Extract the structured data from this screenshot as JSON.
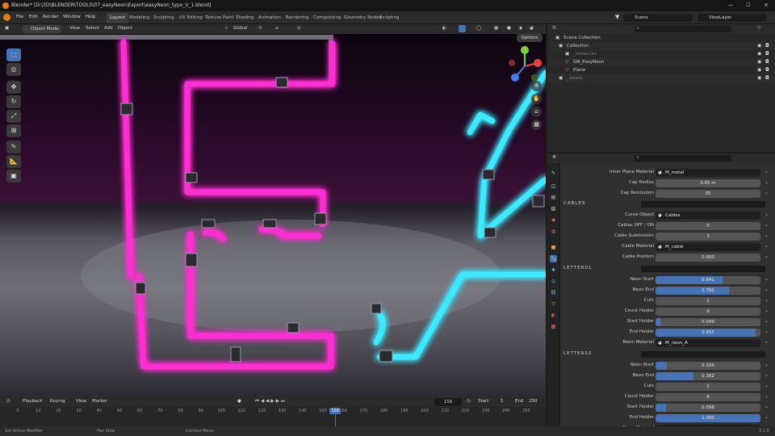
{
  "titlebar": {
    "title": "Blender* [D:\\3D\\BLENDER\\TOOLS\\07_easyNeon\\Export\\easyNeon_typo_V_1.blend]"
  },
  "menu": [
    "File",
    "Edit",
    "Render",
    "Window",
    "Help"
  ],
  "workspaces": [
    "Layout",
    "Modeling",
    "Sculpting",
    "UV Editing",
    "Texture Paint",
    "Shading",
    "Animation",
    "Rendering",
    "Compositing",
    "Geometry Nodes",
    "Scripting"
  ],
  "scene": {
    "scene_name": "Scene",
    "view_layer": "ViewLayer"
  },
  "viewport_header": {
    "mode": "Object Mode",
    "menus": [
      "View",
      "Select",
      "Add",
      "Object"
    ],
    "orientation": "Global",
    "options": "Options"
  },
  "timeline": {
    "menus": [
      "Playback",
      "Keying",
      "View",
      "Marker"
    ],
    "current_frame": "156",
    "start_label": "Start",
    "start": "1",
    "end_label": "End",
    "end": "250",
    "ticks": [
      "0",
      "10",
      "20",
      "30",
      "40",
      "50",
      "60",
      "70",
      "80",
      "90",
      "100",
      "110",
      "120",
      "130",
      "140",
      "150",
      "160",
      "170",
      "180",
      "190",
      "200",
      "210",
      "220",
      "230",
      "240",
      "250"
    ],
    "playhead": "156"
  },
  "statusbar": {
    "left": "Set Active Modifier",
    "middle": "Pan View",
    "right": "Context Menu",
    "version": "3.1.0"
  },
  "outliner": {
    "rows": [
      {
        "label": "Scene Collection",
        "selected": false
      },
      {
        "label": "Collection",
        "selected": false
      },
      {
        "label": "_instances",
        "selected": false
      },
      {
        "label": "GN_EasyNeon",
        "selected": true
      },
      {
        "label": "Plane",
        "selected": false
      },
      {
        "label": "_assets",
        "selected": false
      }
    ]
  },
  "properties": {
    "inner_plane_material": {
      "label": "Inner Plane Material",
      "value": "M_metal"
    },
    "cap_radius": {
      "label": "Cap Radius",
      "value": "0.05 m"
    },
    "cap_resolution": {
      "label": "Cap Resolution",
      "value": "35"
    },
    "cables_section": "CABLES",
    "curve_object": {
      "label": "Curve Object",
      "value": "Cables"
    },
    "cables_off_on": {
      "label": "Cables OFF / ON",
      "value": "0"
    },
    "cable_subdivision": {
      "label": "Cable Subdivision",
      "value": "3"
    },
    "cable_material": {
      "label": "Cable Material",
      "value": "M_cable"
    },
    "cable_position": {
      "label": "Cable Position",
      "value": "0.000"
    },
    "letter01_section": "LETTER01",
    "letter01": [
      {
        "label": "Neon Start",
        "value": "0.641",
        "fill": 0.641
      },
      {
        "label": "Neon End",
        "value": "0.700",
        "fill": 0.7
      },
      {
        "label": "Cuts",
        "value": "1",
        "fill": 0
      },
      {
        "label": "Count Holder",
        "value": "9",
        "fill": 0
      },
      {
        "label": "Start Holder",
        "value": "0.049",
        "fill": 0.049
      },
      {
        "label": "End Holder",
        "value": "0.955",
        "fill": 0.955
      }
    ],
    "neon_material_a": {
      "label": "Neon Material",
      "value": "M_neon_A"
    },
    "letter02_section": "LETTER02",
    "letter02": [
      {
        "label": "Neon Start",
        "value": "0.104",
        "fill": 0.104
      },
      {
        "label": "Neon End",
        "value": "0.362",
        "fill": 0.362
      },
      {
        "label": "Cuts",
        "value": "1",
        "fill": 0
      },
      {
        "label": "Count Holder",
        "value": "4",
        "fill": 0
      },
      {
        "label": "Start Holder",
        "value": "0.098",
        "fill": 0.098
      },
      {
        "label": "End Holder",
        "value": "1.000",
        "fill": 1.0
      }
    ],
    "neon_material_b": {
      "label": "Neon Material",
      "value": "M_neon_B"
    }
  },
  "colors": {
    "accent": "#4772b3",
    "neon_pink": "#ff2fd2",
    "neon_cyan": "#3de9ff",
    "selection": "#334d80"
  },
  "icons": [
    "blender-logo-icon",
    "cursor-icon",
    "move-icon",
    "rotate-icon",
    "scale-icon",
    "transform-icon",
    "annotate-icon",
    "measure-icon",
    "add-cube-icon",
    "eye-icon",
    "camera-icon",
    "search-icon",
    "play-icon"
  ]
}
